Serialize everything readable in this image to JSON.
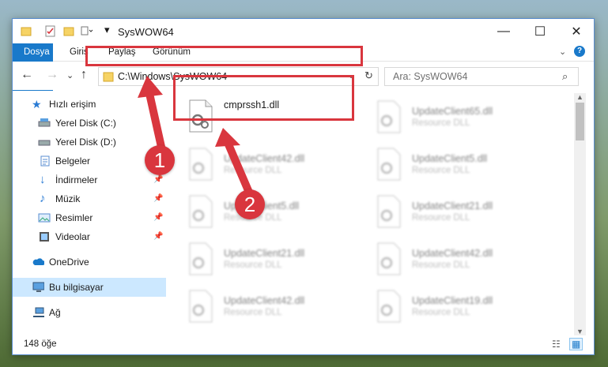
{
  "window": {
    "title": "SysWOW64"
  },
  "ribbon": {
    "tabs": [
      "Dosya",
      "Giriş",
      "Paylaş",
      "Görünüm"
    ]
  },
  "address": {
    "path": "C:\\Windows\\SysWOW64"
  },
  "search": {
    "placeholder": "Ara: SysWOW64"
  },
  "sidebar": {
    "items": [
      {
        "label": "Hızlı erişim",
        "icon": "star-icon"
      },
      {
        "label": "Yerel Disk (C:)",
        "icon": "drive-icon"
      },
      {
        "label": "Yerel Disk (D:)",
        "icon": "drive-icon"
      },
      {
        "label": "Belgeler",
        "icon": "documents-icon"
      },
      {
        "label": "İndirmeler",
        "icon": "download-icon"
      },
      {
        "label": "Müzik",
        "icon": "music-icon"
      },
      {
        "label": "Resimler",
        "icon": "pictures-icon"
      },
      {
        "label": "Videolar",
        "icon": "videos-icon"
      },
      {
        "label": "OneDrive",
        "icon": "cloud-icon"
      },
      {
        "label": "Bu bilgisayar",
        "icon": "computer-icon"
      },
      {
        "label": "Ağ",
        "icon": "network-icon"
      }
    ]
  },
  "files": {
    "main": {
      "name": "cmprssh1.dll"
    },
    "left": [
      {
        "name": "UpdateClient42.dll",
        "type": "Resource DLL"
      },
      {
        "name": "UpdateClient5.dll",
        "type": "Resource DLL"
      },
      {
        "name": "UpdateClient21.dll",
        "type": "Resource DLL"
      },
      {
        "name": "UpdateClient42.dll",
        "type": "Resource DLL"
      }
    ],
    "right": [
      {
        "name": "UpdateClient65.dll",
        "type": "Resource DLL"
      },
      {
        "name": "UpdateClient5.dll",
        "type": "Resource DLL"
      },
      {
        "name": "UpdateClient21.dll",
        "type": "Resource DLL"
      },
      {
        "name": "UpdateClient42.dll",
        "type": "Resource DLL"
      },
      {
        "name": "UpdateClient19.dll",
        "type": "Resource DLL"
      }
    ]
  },
  "status": {
    "count": "148 öğe"
  },
  "annotations": {
    "badge1": "1",
    "badge2": "2"
  },
  "colors": {
    "accent": "#1979ca",
    "highlight": "#d9363e",
    "selection": "#cce8ff"
  }
}
